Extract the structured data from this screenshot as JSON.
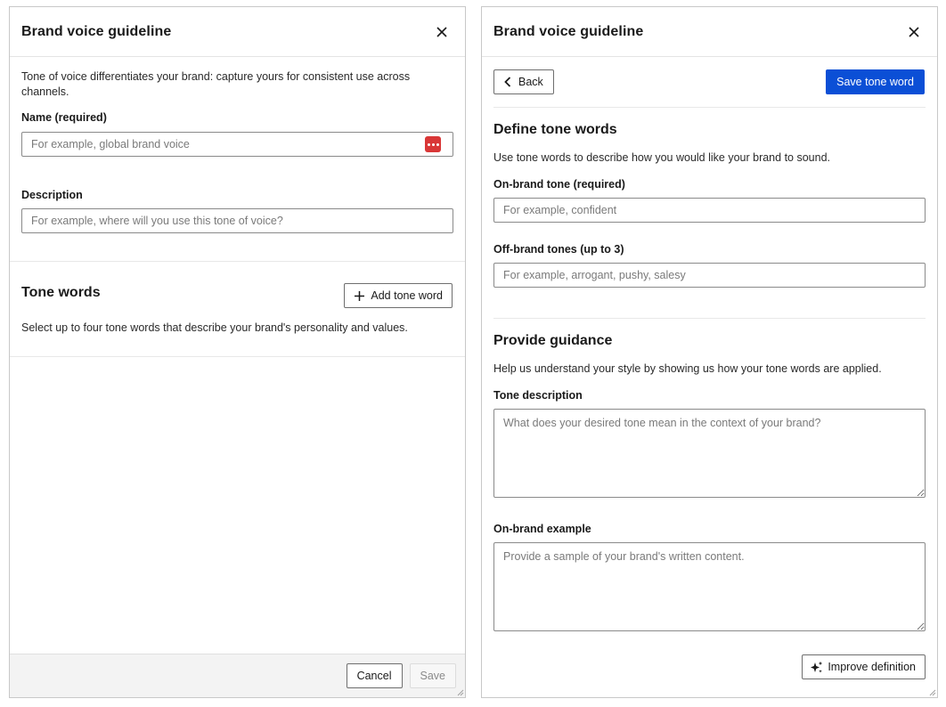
{
  "left_panel": {
    "title": "Brand voice guideline",
    "intro": "Tone of voice differentiates your brand: capture yours for consistent use across channels.",
    "name_label": "Name (required)",
    "name_placeholder": "For example, global brand voice",
    "description_label": "Description",
    "description_placeholder": "For example, where will you use this tone of voice?",
    "tone_words_title": "Tone words",
    "add_tone_word_label": "Add tone word",
    "tone_words_text": "Select up to four tone words that describe your brand's personality and values.",
    "cancel_label": "Cancel",
    "save_label": "Save"
  },
  "right_panel": {
    "title": "Brand voice guideline",
    "back_label": "Back",
    "save_tone_word_label": "Save tone word",
    "define_title": "Define tone words",
    "define_text": "Use tone words to describe how you would like your brand to sound.",
    "on_brand_label": "On-brand tone (required)",
    "on_brand_placeholder": "For example, confident",
    "off_brand_label": "Off-brand tones (up to 3)",
    "off_brand_placeholder": "For example, arrogant, pushy, salesy",
    "guidance_title": "Provide guidance",
    "guidance_text": "Help us understand your style by showing us how your tone words are applied.",
    "tone_description_label": "Tone description",
    "tone_description_placeholder": "What does your desired tone mean in the context of your brand?",
    "example_label": "On-brand example",
    "example_placeholder": "Provide a sample of your brand's written content.",
    "improve_label": "Improve definition"
  },
  "colors": {
    "primary": "#0b4fd6",
    "password_manager_icon": "#d93737"
  },
  "icons": [
    "close-icon",
    "chevron-left-icon",
    "plus-icon",
    "sparkle-icon",
    "password-manager-icon"
  ]
}
